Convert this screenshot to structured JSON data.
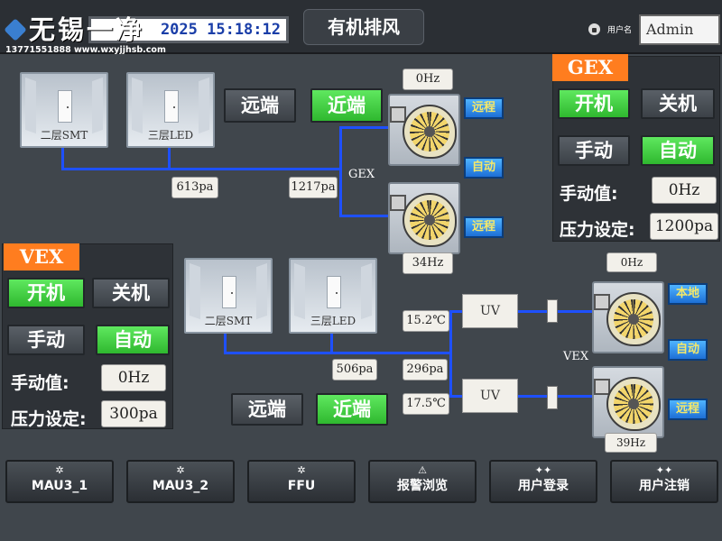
{
  "header": {
    "watermark_title": "无锡一净",
    "watermark_line": "13771551888 www.wxyjjhsb.com",
    "datetime": "2025 15:18:12",
    "page_title": "有机排风",
    "user_label": "用户名",
    "user_value": "Admin"
  },
  "gex_section": {
    "rooms": [
      "二层SMT",
      "三层LED"
    ],
    "remote_button": "远端",
    "local_button": "近端",
    "fan1_freq": "0Hz",
    "fan2_freq": "34Hz",
    "fan1_tags": [
      "远程",
      "自动"
    ],
    "fan2_tags": [
      "远程"
    ],
    "pressure_left": "613pa",
    "pressure_right": "1217pa",
    "group_label": "GEX"
  },
  "gex_panel": {
    "tag": "GEX",
    "on_button": "开机",
    "off_button": "关机",
    "manual_button": "手动",
    "auto_button": "自动",
    "manual_value_label": "手动值:",
    "manual_value": "0Hz",
    "pressure_label": "压力设定:",
    "pressure_value": "1200pa"
  },
  "vex_panel": {
    "tag": "VEX",
    "on_button": "开机",
    "off_button": "关机",
    "manual_button": "手动",
    "auto_button": "自动",
    "manual_value_label": "手动值:",
    "manual_value": "0Hz",
    "pressure_label": "压力设定:",
    "pressure_value": "300pa"
  },
  "vex_section": {
    "rooms": [
      "二层SMT",
      "三层LED"
    ],
    "temp1": "15.2℃",
    "temp2": "17.5℃",
    "pressure_left": "506pa",
    "pressure_right": "296pa",
    "uv_label": "UV",
    "remote_button": "远端",
    "local_button": "近端",
    "fan1_freq": "0Hz",
    "fan2_freq": "39Hz",
    "fan1_tags": [
      "本地",
      "自动"
    ],
    "fan2_tags": [
      "远程"
    ],
    "group_label": "VEX"
  },
  "nav": [
    "MAU3_1",
    "MAU3_2",
    "FFU",
    "报警浏览",
    "用户登录",
    "用户注销"
  ],
  "colors": {
    "accent_green": "#3fcf3f",
    "accent_orange": "#ff7d1f",
    "pipe_blue": "#1e50ff",
    "tag_blue": "#2a86e8"
  }
}
